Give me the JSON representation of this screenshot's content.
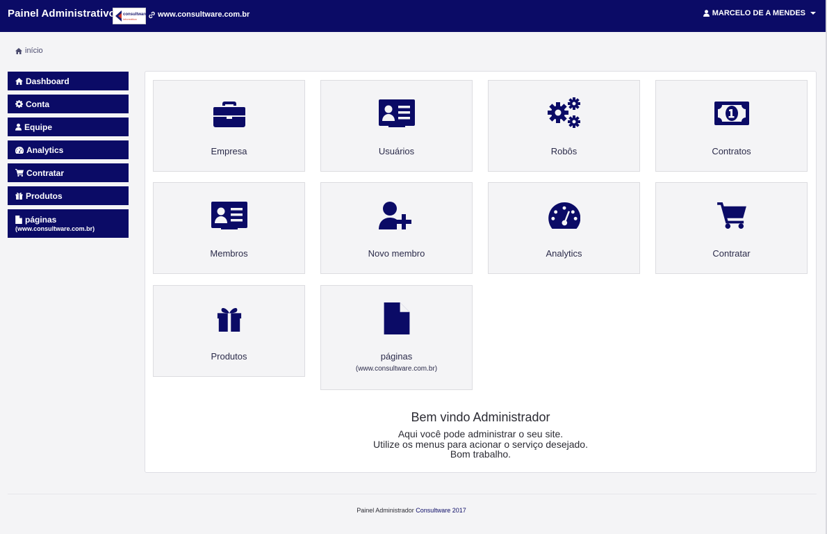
{
  "topbar": {
    "title": "Painel Administrativo",
    "logo_text": "consultware",
    "logo_subtext": "informática",
    "site_link": "www.consultware.com.br",
    "user_name": "MARCELO DE A MENDES"
  },
  "breadcrumb": {
    "home": "início"
  },
  "sidebar": {
    "items": [
      {
        "label": "Dashboard",
        "icon": "home-icon"
      },
      {
        "label": "Conta",
        "icon": "gear-icon"
      },
      {
        "label": "Equipe",
        "icon": "user-icon"
      },
      {
        "label": "Analytics",
        "icon": "dashboard-icon"
      },
      {
        "label": "Contratar",
        "icon": "cart-icon"
      },
      {
        "label": "Produtos",
        "icon": "gift-icon"
      },
      {
        "label": "páginas",
        "sublabel": "(www.consultware.com.br)",
        "icon": "file-icon"
      }
    ]
  },
  "tiles": [
    {
      "label": "Empresa",
      "icon": "briefcase-icon"
    },
    {
      "label": "Usuários",
      "icon": "id-card-icon"
    },
    {
      "label": "Robôs",
      "icon": "gears-icon"
    },
    {
      "label": "Contratos",
      "icon": "money-icon"
    },
    {
      "label": "Membros",
      "icon": "id-card-icon"
    },
    {
      "label": "Novo membro",
      "icon": "user-plus-icon"
    },
    {
      "label": "Analytics",
      "icon": "dashboard-icon"
    },
    {
      "label": "Contratar",
      "icon": "cart-icon"
    },
    {
      "label": "Produtos",
      "icon": "gift-icon"
    },
    {
      "label": "páginas",
      "sublabel": "(www.consultware.com.br)",
      "icon": "file-icon"
    }
  ],
  "welcome": {
    "title": "Bem vindo Administrador",
    "line1": "Aqui você pode administrar o seu site.",
    "line2": "Utilize os menus para acionar o serviço desejado.",
    "line3": "Bom trabalho."
  },
  "footer": {
    "text": "Painel Administrador",
    "brand": "Consultware 2017"
  },
  "colors": {
    "primary": "#0b0b66",
    "background": "#f4f4f6",
    "tile": "#f4f4f6"
  }
}
